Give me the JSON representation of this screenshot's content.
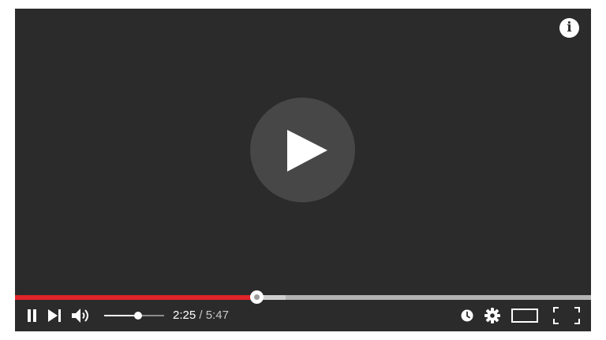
{
  "player": {
    "time": {
      "current": "2:25",
      "separator": " / ",
      "duration": "5:47"
    },
    "progress": {
      "played_fraction": 0.42,
      "buffered_fraction": 0.47
    },
    "volume": {
      "level_fraction": 0.57
    },
    "icons": {
      "info": "i",
      "big_play": "play-icon",
      "pause": "pause-icon",
      "next": "next-icon",
      "volume": "volume-icon",
      "watch_later": "clock-icon",
      "settings": "gear-icon",
      "theater": "theater-mode-icon",
      "fullscreen": "fullscreen-icon"
    },
    "colors": {
      "background": "#2b2b2b",
      "progress_played": "#e0242a",
      "progress_track": "#b3b3b3",
      "big_play_circle": "#474747",
      "icons": "#ffffff"
    }
  }
}
